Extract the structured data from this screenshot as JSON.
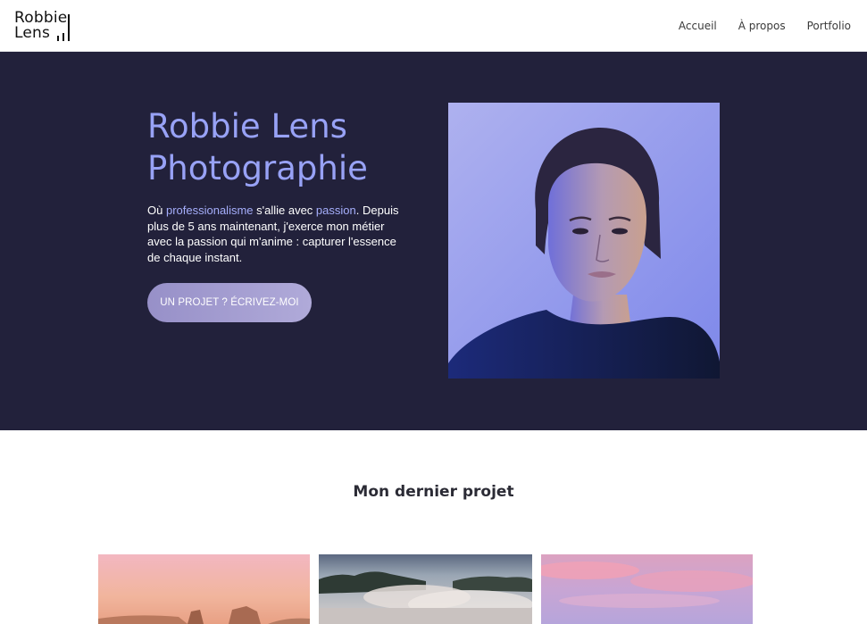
{
  "brand": {
    "line1": "Robbie",
    "line2": "Lens"
  },
  "nav": {
    "items": [
      "Accueil",
      "À propos",
      "Portfolio"
    ]
  },
  "hero": {
    "title_line1": "Robbie Lens",
    "title_line2": "Photographie",
    "text_prefix": "Où ",
    "text_highlight1": "professionalisme",
    "text_middle": " s'allie avec ",
    "text_highlight2": "passion",
    "text_suffix": ".",
    "text_body": "Depuis plus de 5 ans maintenant, j'exerce mon métier avec la passion qui m'anime : capturer l'essence de chaque instant.",
    "cta_label": "UN PROJET ? ÉCRIVEZ-MOI"
  },
  "projects": {
    "section_title": "Mon dernier projet",
    "thumbnails": [
      "coastal-rocks-sunset-photo",
      "geothermal-lake-steam-photo",
      "pink-sky-sunset-photo"
    ]
  },
  "colors": {
    "hero_bg": "#22213b",
    "accent": "#98a2f6",
    "cta": "#a59fd1"
  }
}
